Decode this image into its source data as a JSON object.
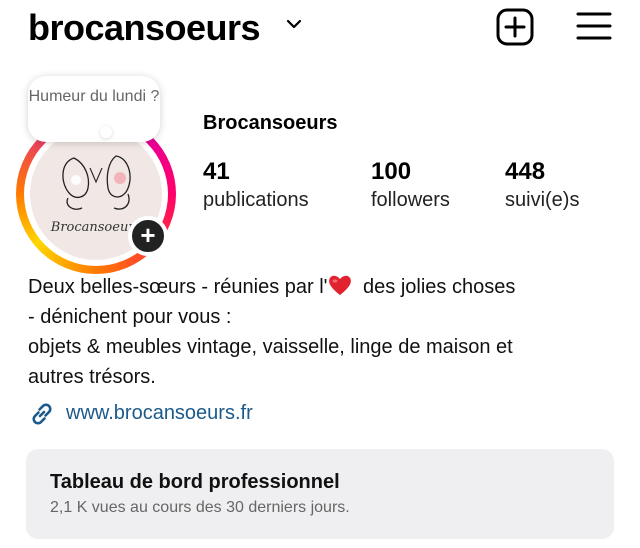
{
  "header": {
    "username": "brocansoeurs",
    "icons": {
      "dropdown": "chevron-down-icon",
      "create": "plus-square-icon",
      "menu": "hamburger-menu-icon"
    }
  },
  "profile": {
    "note": "Humeur du lundi ?",
    "avatar_text": "Brocansoeurs",
    "display_name": "Brocansoeurs",
    "stats": [
      {
        "value": "41",
        "label": "publications"
      },
      {
        "value": "100",
        "label": "followers"
      },
      {
        "value": "448",
        "label": "suivi(e)s"
      }
    ],
    "bio": {
      "line1_before": "Deux belles-sœurs - réunies par l'",
      "line1_after": " des jolies choses",
      "line2": "- dénichent pour vous :",
      "line3": "objets & meubles vintage, vaisselle, linge de maison et",
      "line4": "autres trésors."
    },
    "link": "www.brocansoeurs.fr"
  },
  "dashboard": {
    "title": "Tableau de bord professionnel",
    "subtitle": "2,1 K vues au cours des 30 derniers jours."
  },
  "colors": {
    "link": "#1c5a8b",
    "heart": "#e0232e",
    "card_bg": "#efeff1"
  }
}
